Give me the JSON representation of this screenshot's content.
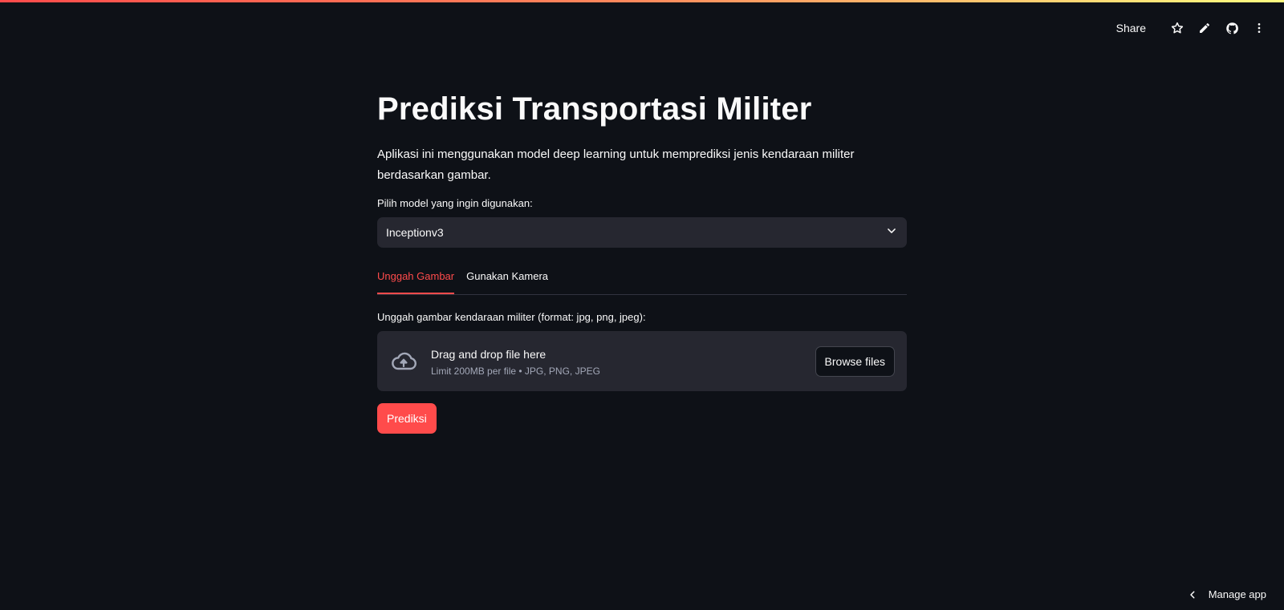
{
  "toolbar": {
    "share_label": "Share",
    "icons": [
      "star-icon",
      "pencil-icon",
      "github-icon",
      "more-vertical-icon"
    ]
  },
  "main": {
    "title": "Prediksi Transportasi Militer",
    "description": "Aplikasi ini menggunakan model deep learning untuk memprediksi jenis kendaraan militer berdasarkan gambar.",
    "model_select": {
      "label": "Pilih model yang ingin digunakan:",
      "selected": "Inceptionv3"
    },
    "tabs": [
      {
        "label": "Unggah Gambar",
        "active": true
      },
      {
        "label": "Gunakan Kamera",
        "active": false
      }
    ],
    "uploader": {
      "label": "Unggah gambar kendaraan militer (format: jpg, png, jpeg):",
      "title": "Drag and drop file here",
      "subtitle": "Limit 200MB per file • JPG, PNG, JPEG",
      "browse_label": "Browse files"
    },
    "predict_label": "Prediksi"
  },
  "footer": {
    "manage_label": "Manage app"
  },
  "colors": {
    "background": "#0e1117",
    "surface": "#262730",
    "accent": "#ff4b4b",
    "text": "#fafafa"
  }
}
